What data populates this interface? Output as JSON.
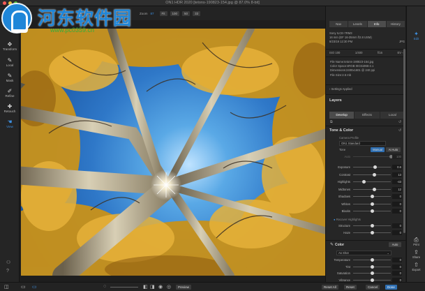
{
  "window": {
    "title": "ON1 HDR 2020 [tetons-190823-154.jpg @ 87.0% 8-bit]"
  },
  "watermark": {
    "name": "河东软件园",
    "url": "www.pc0359.cn"
  },
  "zoom": {
    "label": "Zoom",
    "value": "87",
    "buttons": [
      "Fit",
      "100",
      "50",
      "33"
    ]
  },
  "left_tools": [
    {
      "label": "Transform",
      "icon": "move-icon"
    },
    {
      "label": "Local",
      "icon": "brush-icon"
    },
    {
      "label": "Mask",
      "icon": "mask-brush-icon"
    },
    {
      "label": "Refine",
      "icon": "refine-brush-icon"
    },
    {
      "label": "Retouch",
      "icon": "retouch-icon"
    },
    {
      "label": "View",
      "icon": "hand-icon"
    }
  ],
  "panel_tabs": [
    "Nav",
    "Levels",
    "Info",
    "History"
  ],
  "panel_active_tab": "Info",
  "info": {
    "camera": "Sony ILCE-7RM3",
    "lens": "16 mm (EF 16-35mm f/2.8 USM)",
    "date": "8/23/19 12:30 PM",
    "format": "JPG",
    "iso": "ISO 100",
    "shutter": "1/400",
    "aperture": "f/16",
    "ev": "EV -3",
    "file_name": "File Name:tetons-190823-154.jpg",
    "color_space": "Color Space:sRGB IEC61966-2.1",
    "dimensions": "Dimensions:2400x1601 @ 240 ppi",
    "file_size": "File Size:2.6 mb"
  },
  "settings_applied": "Settings Applied",
  "layers": {
    "title": "Layers",
    "subtabs": [
      "Develop",
      "Effects",
      "Local"
    ],
    "active": "Develop"
  },
  "tone": {
    "title": "Tone & Color",
    "camera_profile_label": "Camera Profile",
    "camera_profile_value": "ON1 Standard",
    "tone_label": "Tone",
    "mode_buttons": [
      "Manual",
      "AI Auto"
    ],
    "auto_label": "Auto",
    "auto_value": "100"
  },
  "sliders": [
    {
      "label": "Exposure",
      "value": "0.6",
      "pos": 0.58
    },
    {
      "label": "Contrast",
      "value": "13",
      "pos": 0.56
    },
    {
      "label": "Highlights",
      "value": "-43",
      "pos": 0.28
    },
    {
      "label": "Midtones",
      "value": "12",
      "pos": 0.56
    },
    {
      "label": "Shadows",
      "value": "0",
      "pos": 0.5
    },
    {
      "label": "Whites",
      "value": "0",
      "pos": 0.5
    },
    {
      "label": "Blacks",
      "value": "0",
      "pos": 0.5
    }
  ],
  "recover_highlights": "Recover Highlights",
  "detail_sliders": [
    {
      "label": "Structure",
      "value": "0",
      "pos": 0.5
    },
    {
      "label": "Haze",
      "value": "0",
      "pos": 0.5
    }
  ],
  "color": {
    "title": "Color",
    "auto_button": "Auto",
    "preset": "As Shot"
  },
  "color_sliders": [
    {
      "label": "Temperature",
      "value": "0",
      "pos": 0.5
    },
    {
      "label": "Tint",
      "value": "0",
      "pos": 0.5
    },
    {
      "label": "Saturation",
      "value": "0",
      "pos": 0.5
    },
    {
      "label": "Vibrance",
      "value": "0",
      "pos": 0.5
    }
  ],
  "far_right": [
    {
      "label": "Edit",
      "icon": "edit-icon"
    },
    {
      "label": "Print",
      "icon": "print-icon"
    },
    {
      "label": "Share",
      "icon": "share-icon"
    },
    {
      "label": "Export",
      "icon": "export-icon"
    }
  ],
  "bottom": {
    "preview": "Preview",
    "buttons": [
      "Reset All",
      "Reset",
      "Cancel",
      "Done"
    ]
  }
}
